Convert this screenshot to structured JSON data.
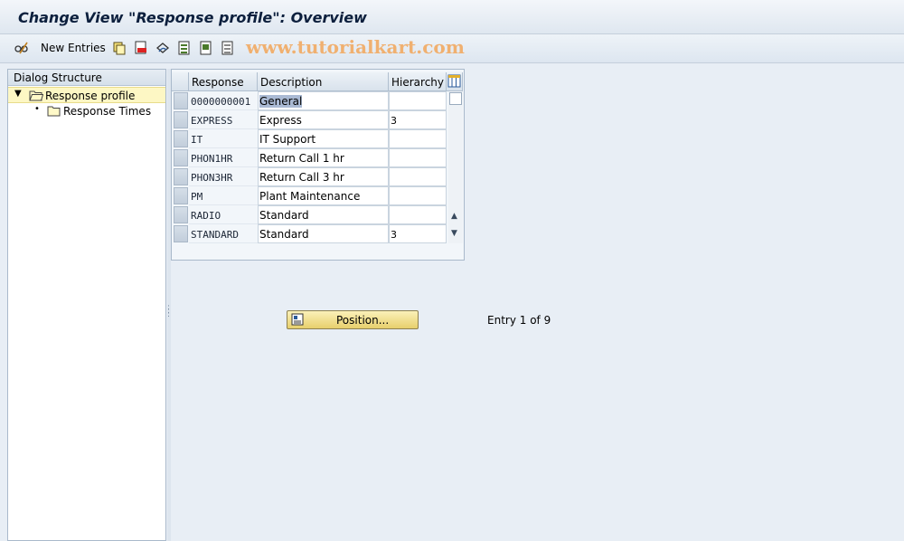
{
  "window": {
    "title": "Change View \"Response profile\": Overview"
  },
  "toolbar": {
    "new_entries_label": "New Entries",
    "icons": [
      "glasses-pencil-icon",
      "copy-icon",
      "delete-icon",
      "undo-icon",
      "select-all-icon",
      "select-block-icon",
      "deselect-all-icon"
    ],
    "watermark": "www.tutorialkart.com"
  },
  "dialog_structure": {
    "header": "Dialog Structure",
    "items": [
      {
        "label": "Response profile",
        "selected": true,
        "expanded": true
      },
      {
        "label": "Response Times",
        "selected": false
      }
    ]
  },
  "table": {
    "columns": [
      "Response",
      "Description",
      "Hierarchy"
    ],
    "rows": [
      {
        "response": "0000000001",
        "description": "General",
        "hierarchy": ""
      },
      {
        "response": "EXPRESS",
        "description": "Express",
        "hierarchy": "3"
      },
      {
        "response": "IT",
        "description": "IT Support",
        "hierarchy": ""
      },
      {
        "response": "PHON1HR",
        "description": "Return Call 1 hr",
        "hierarchy": ""
      },
      {
        "response": "PHON3HR",
        "description": "Return Call 3 hr",
        "hierarchy": ""
      },
      {
        "response": "PM",
        "description": "Plant Maintenance",
        "hierarchy": ""
      },
      {
        "response": "RADIO",
        "description": "Standard",
        "hierarchy": ""
      },
      {
        "response": "STANDARD",
        "description": "Standard",
        "hierarchy": "3"
      }
    ]
  },
  "footer": {
    "position_button": "Position...",
    "entry_info": "Entry 1 of 9"
  },
  "colors": {
    "background": "#e8eef5",
    "selected_tree_item": "#fdf7c4",
    "button_yellow": "#f3e392",
    "highlight": "#aabad4"
  }
}
